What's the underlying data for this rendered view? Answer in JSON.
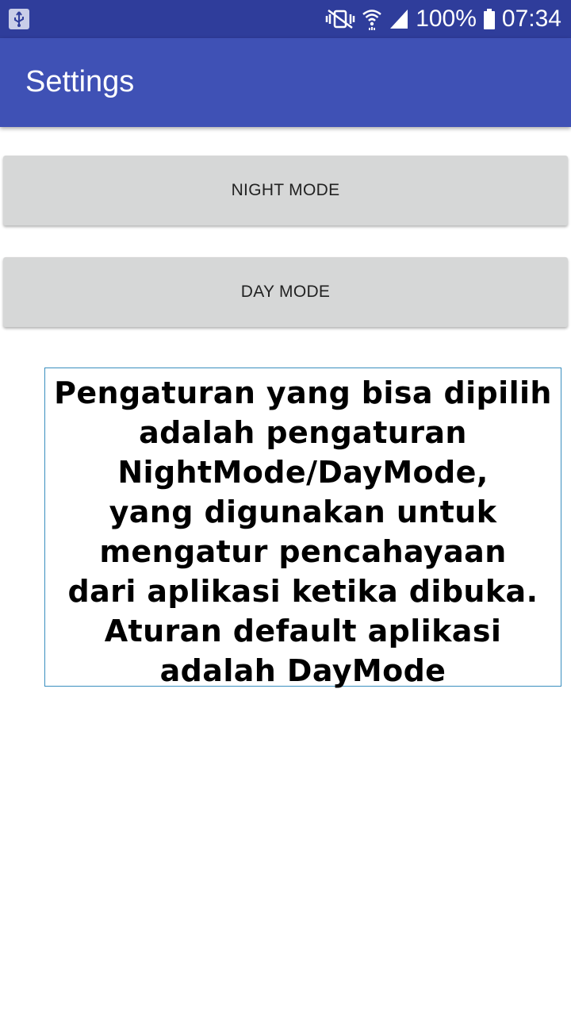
{
  "status_bar": {
    "battery": "100%",
    "time": "07:34",
    "icons": [
      "usb-icon",
      "vibrate-mute-icon",
      "wifi-icon",
      "signal-icon",
      "battery-icon"
    ]
  },
  "app_bar": {
    "title": "Settings"
  },
  "buttons": {
    "night_mode": "NIGHT MODE",
    "day_mode": "DAY MODE"
  },
  "description": {
    "lines": [
      "Pengaturan yang bisa dipilih",
      "adalah pengaturan",
      "NightMode/DayMode,",
      "yang digunakan untuk",
      "mengatur pencahayaan",
      "dari aplikasi ketika dibuka.",
      "Aturan default aplikasi",
      "adalah DayMode"
    ]
  },
  "colors": {
    "status_bar": "#2f3d9b",
    "app_bar": "#3f51b5",
    "button": "#d6d7d7",
    "box_border": "#3a8fbf"
  }
}
